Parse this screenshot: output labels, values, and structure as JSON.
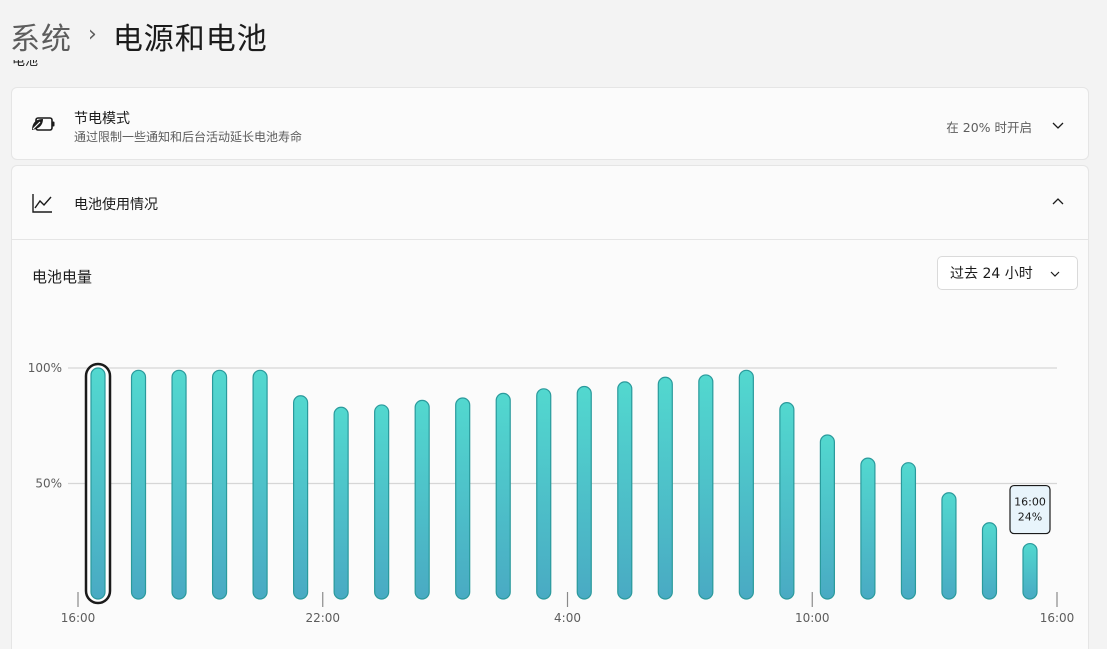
{
  "breadcrumb": {
    "parent": "系统",
    "current": "电源和电池"
  },
  "section_label": "电池",
  "battery_saver": {
    "title": "节电模式",
    "description": "通过限制一些通知和后台活动延长电池寿命",
    "status": "在 20% 时开启",
    "icon": "battery-leaf-icon"
  },
  "battery_usage": {
    "title": "电池使用情况",
    "icon": "line-chart-icon",
    "level_label": "电池电量",
    "range_select": {
      "selected": "过去 24 小时"
    }
  },
  "colors": {
    "bar_top": "#52d8cf",
    "bar_bottom": "#49aac3",
    "bar_stroke": "#2a9a9c",
    "gridline": "#d6d6d6",
    "tooltip_bg": "#e8f4fb"
  },
  "chart_data": {
    "type": "bar",
    "title": "电池电量",
    "x_tick_labels": [
      "16:00",
      "22:00",
      "4:00",
      "10:00",
      "16:00"
    ],
    "y_tick_labels": [
      "100%",
      "50%"
    ],
    "ylim": [
      0,
      100
    ],
    "values": [
      100,
      99,
      99,
      99,
      99,
      88,
      83,
      84,
      86,
      87,
      89,
      91,
      92,
      94,
      96,
      97,
      99,
      85,
      71,
      61,
      59,
      46,
      33,
      24
    ],
    "selected_index": 0,
    "tooltip": {
      "bar_index": 23,
      "time": "16:00",
      "value": "24%"
    },
    "grid": true
  }
}
